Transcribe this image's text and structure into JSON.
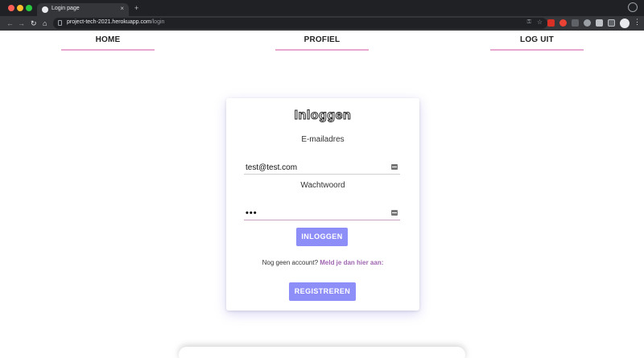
{
  "browser": {
    "tab_title": "Login page",
    "tab_close": "×",
    "new_tab": "+",
    "url_host": "project-tech-2021.herokuapp.com",
    "url_path": "/login",
    "nav_back": "←",
    "nav_forward": "→",
    "nav_reload": "↻",
    "nav_home": "⌂",
    "key_icon": "⚿",
    "star_icon": "☆",
    "menu_icon": "⋮"
  },
  "nav": {
    "home": "HOME",
    "profile": "PROFIEL",
    "logout": "LOG UIT"
  },
  "login": {
    "title": "Inloggen",
    "email_label": "E-mailadres",
    "email_value": "test@test.com",
    "password_label": "Wachtwoord",
    "password_value": "•••",
    "login_button": "INLOGGEN",
    "no_account_text": "Nog geen account?",
    "register_link": "Meld je dan hier aan:",
    "register_button": "REGISTREREN"
  },
  "colors": {
    "accent_button": "#8e8ef8",
    "nav_underline": "#e8a7cf",
    "link": "#a066b0"
  }
}
